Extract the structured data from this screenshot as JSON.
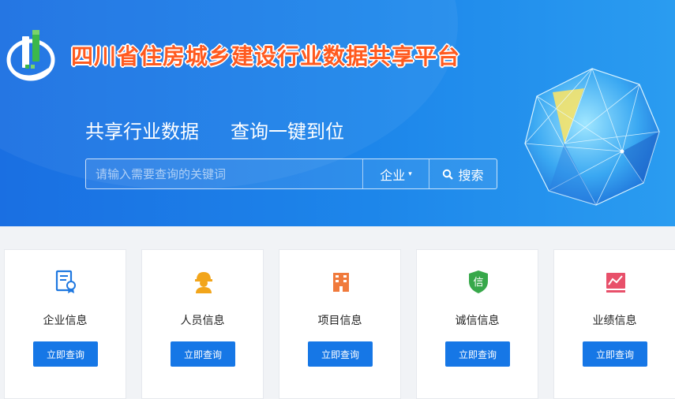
{
  "header": {
    "site_title": "四川省住房城乡建设行业数据共享平台",
    "slogan_left": "共享行业数据",
    "slogan_right": "查询一键到位"
  },
  "search": {
    "placeholder": "请输入需要查询的关键词",
    "category": "企业",
    "button_label": "搜索"
  },
  "cards": [
    {
      "label": "企业信息",
      "button": "立即查询",
      "icon": "enterprise-certificate-icon",
      "color": "#1f78e0"
    },
    {
      "label": "人员信息",
      "button": "立即查询",
      "icon": "worker-helmet-icon",
      "color": "#f2a51a"
    },
    {
      "label": "项目信息",
      "button": "立即查询",
      "icon": "building-icon",
      "color": "#f07a3c"
    },
    {
      "label": "诚信信息",
      "button": "立即查询",
      "icon": "integrity-shield-icon",
      "color": "#37a84a"
    },
    {
      "label": "业绩信息",
      "button": "立即查询",
      "icon": "performance-chart-icon",
      "color": "#e8506a"
    }
  ],
  "colors": {
    "banner": "#1a7be6",
    "title": "#ff5a1f",
    "button": "#1677e6"
  }
}
